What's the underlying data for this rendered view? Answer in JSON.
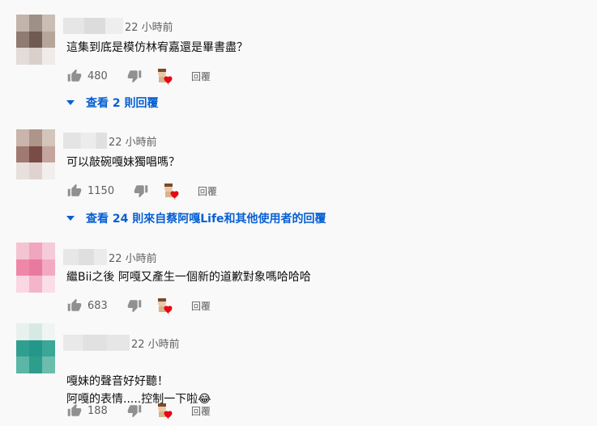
{
  "comments": [
    {
      "time": "22 小時前",
      "text": "這集到底是模仿林宥嘉還是畢書盡？",
      "likes": "480",
      "reply_label": "回覆",
      "view_replies": "查看 2 則回覆",
      "avatar_colors": [
        "#c3b4ab",
        "#9e9086",
        "#c9bdb5",
        "#8e7b71",
        "#6f5b53",
        "#b6a59b",
        "#e3dcd8",
        "#d9d0cb",
        "#f0ebe8"
      ],
      "name_blur_colors": [
        "#e6e6e6",
        "#dcdcdc",
        "#eeeeee"
      ]
    },
    {
      "time": "22 小時前",
      "text": "可以敲碗嘎妹獨唱嗎？",
      "likes": "1150",
      "reply_label": "回覆",
      "view_replies": "查看 24 則來自蔡阿嘎Life和其他使用者的回覆",
      "avatar_colors": [
        "#c9b5ab",
        "#ad958a",
        "#d3c4bc",
        "#a07a70",
        "#7a4b47",
        "#c4a59e",
        "#e8e0dc",
        "#e0d3cf",
        "#f2eeec"
      ],
      "name_blur_colors": [
        "#e4e4e4",
        "#ececec",
        "#e0e0e0"
      ]
    },
    {
      "time": "22 小時前",
      "text": "繼Bii之後 阿嘎又產生一個新的道歉對象嗎哈哈哈",
      "likes": "683",
      "reply_label": "回覆",
      "avatar_colors": [
        "#f5c4d3",
        "#f0a6be",
        "#f6cbd9",
        "#ef87a9",
        "#e87aa0",
        "#f3a9c2",
        "#fad7e3",
        "#f4b4c9",
        "#fbdde7"
      ],
      "name_blur_colors": [
        "#e7e7e7",
        "#dfdfdf",
        "#ebebeb"
      ]
    },
    {
      "time": "22 小時前",
      "text": "嘎妹的聲音好好聽！\n阿嘎的表情.....控制一下啦",
      "emoji": "😂",
      "likes": "188",
      "reply_label": "回覆",
      "avatar_colors": [
        "#e8f1ee",
        "#d7e9e3",
        "#eef5f2",
        "#2fa08f",
        "#25968a",
        "#3aa797",
        "#5bb6a6",
        "#2e9d8c",
        "#6cbdae"
      ],
      "name_blur_colors": [
        "#e9e9e9",
        "#e1e1e1",
        "#e6e6e6"
      ]
    }
  ],
  "colors": {
    "link_blue": "#065fd4",
    "secondary_text": "#606060",
    "heart_red": "#e50914"
  },
  "icons": {
    "like": "thumb-up-icon",
    "dislike": "thumb-down-icon",
    "creator_heart": "creator-heart-icon",
    "expand": "caret-down-icon"
  }
}
